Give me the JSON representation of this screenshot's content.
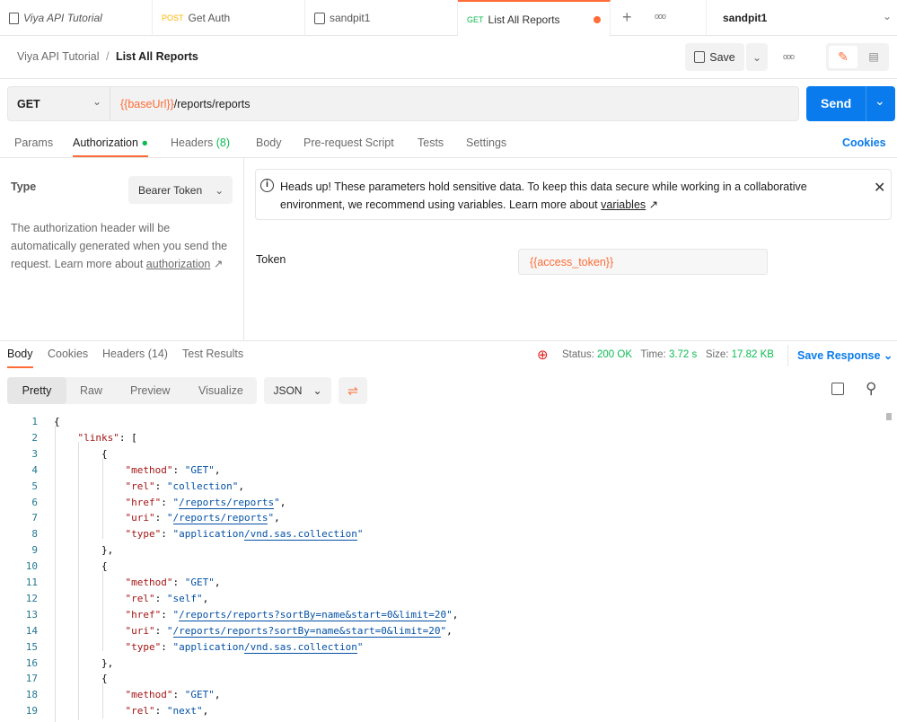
{
  "tabs": [
    {
      "label": "Viya API Tutorial",
      "icon": "collection-icon"
    },
    {
      "method": "POST",
      "label": "Get Auth"
    },
    {
      "label": "sandpit1",
      "icon": "environment-icon"
    },
    {
      "method": "GET",
      "label": "List All Reports",
      "unsaved": true
    }
  ],
  "environment": "sandpit1",
  "breadcrumb": {
    "parent": "Viya API Tutorial",
    "sep": "/",
    "current": "List All Reports"
  },
  "save_label": "Save",
  "request": {
    "method": "GET",
    "url_var": "{{baseUrl}}",
    "url_path": "/reports/reports",
    "send_label": "Send"
  },
  "req_tabs": {
    "params": "Params",
    "authorization": "Authorization",
    "headers": "Headers",
    "headers_count": "(8)",
    "body": "Body",
    "prerequest": "Pre-request Script",
    "tests": "Tests",
    "settings": "Settings",
    "cookies": "Cookies"
  },
  "auth": {
    "type_label": "Type",
    "type_value": "Bearer Token",
    "desc": "The authorization header will be automatically generated when you send the request. Learn more about ",
    "desc_link": "authorization",
    "notice": "Heads up! These parameters hold sensitive data. To keep this data secure while working in a collaborative environment, we recommend using variables. Learn more about ",
    "notice_link": "variables",
    "token_label": "Token",
    "token_value": "{{access_token}}"
  },
  "resp_tabs": {
    "body": "Body",
    "cookies": "Cookies",
    "headers": "Headers (14)",
    "tests": "Test Results"
  },
  "status": {
    "status_label": "Status:",
    "status": "200 OK",
    "time_label": "Time:",
    "time": "3.72 s",
    "size_label": "Size:",
    "size": "17.82 KB",
    "save_response": "Save Response"
  },
  "view": {
    "pretty": "Pretty",
    "raw": "Raw",
    "preview": "Preview",
    "visualize": "Visualize",
    "format": "JSON"
  },
  "colors": {
    "accent": "#ff6c37",
    "send": "#097bed",
    "key": "#a31515",
    "string": "#0451a5"
  },
  "code_lines": [
    [
      0,
      [
        [
          "p",
          "{"
        ]
      ]
    ],
    [
      1,
      [
        [
          "k",
          "\"links\""
        ],
        [
          "p",
          ": ["
        ]
      ]
    ],
    [
      2,
      [
        [
          "p",
          "{"
        ]
      ]
    ],
    [
      3,
      [
        [
          "k",
          "\"method\""
        ],
        [
          "p",
          ": "
        ],
        [
          "s",
          "\"GET\""
        ],
        [
          "p",
          ","
        ]
      ]
    ],
    [
      3,
      [
        [
          "k",
          "\"rel\""
        ],
        [
          "p",
          ": "
        ],
        [
          "s",
          "\"collection\""
        ],
        [
          "p",
          ","
        ]
      ]
    ],
    [
      3,
      [
        [
          "k",
          "\"href\""
        ],
        [
          "p",
          ": "
        ],
        [
          "s",
          "\""
        ],
        [
          "lk",
          "/reports/reports"
        ],
        [
          "s",
          "\""
        ],
        [
          "p",
          ","
        ]
      ]
    ],
    [
      3,
      [
        [
          "k",
          "\"uri\""
        ],
        [
          "p",
          ": "
        ],
        [
          "s",
          "\""
        ],
        [
          "lk",
          "/reports/reports"
        ],
        [
          "s",
          "\""
        ],
        [
          "p",
          ","
        ]
      ]
    ],
    [
      3,
      [
        [
          "k",
          "\"type\""
        ],
        [
          "p",
          ": "
        ],
        [
          "s",
          "\"application"
        ],
        [
          "lk",
          "/vnd.sas.collection"
        ],
        [
          "s",
          "\""
        ]
      ]
    ],
    [
      2,
      [
        [
          "p",
          "},"
        ]
      ]
    ],
    [
      2,
      [
        [
          "p",
          "{"
        ]
      ]
    ],
    [
      3,
      [
        [
          "k",
          "\"method\""
        ],
        [
          "p",
          ": "
        ],
        [
          "s",
          "\"GET\""
        ],
        [
          "p",
          ","
        ]
      ]
    ],
    [
      3,
      [
        [
          "k",
          "\"rel\""
        ],
        [
          "p",
          ": "
        ],
        [
          "s",
          "\"self\""
        ],
        [
          "p",
          ","
        ]
      ]
    ],
    [
      3,
      [
        [
          "k",
          "\"href\""
        ],
        [
          "p",
          ": "
        ],
        [
          "s",
          "\""
        ],
        [
          "lk",
          "/reports/reports?sortBy=name&start=0&limit=20"
        ],
        [
          "s",
          "\""
        ],
        [
          "p",
          ","
        ]
      ]
    ],
    [
      3,
      [
        [
          "k",
          "\"uri\""
        ],
        [
          "p",
          ": "
        ],
        [
          "s",
          "\""
        ],
        [
          "lk",
          "/reports/reports?sortBy=name&start=0&limit=20"
        ],
        [
          "s",
          "\""
        ],
        [
          "p",
          ","
        ]
      ]
    ],
    [
      3,
      [
        [
          "k",
          "\"type\""
        ],
        [
          "p",
          ": "
        ],
        [
          "s",
          "\"application"
        ],
        [
          "lk",
          "/vnd.sas.collection"
        ],
        [
          "s",
          "\""
        ]
      ]
    ],
    [
      2,
      [
        [
          "p",
          "},"
        ]
      ]
    ],
    [
      2,
      [
        [
          "p",
          "{"
        ]
      ]
    ],
    [
      3,
      [
        [
          "k",
          "\"method\""
        ],
        [
          "p",
          ": "
        ],
        [
          "s",
          "\"GET\""
        ],
        [
          "p",
          ","
        ]
      ]
    ],
    [
      3,
      [
        [
          "k",
          "\"rel\""
        ],
        [
          "p",
          ": "
        ],
        [
          "s",
          "\"next\""
        ],
        [
          "p",
          ","
        ]
      ]
    ]
  ]
}
